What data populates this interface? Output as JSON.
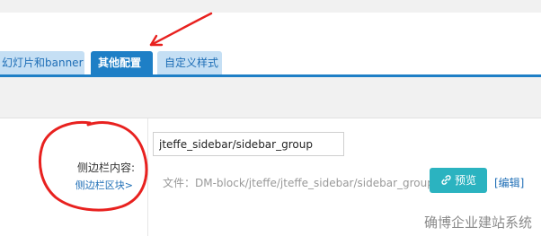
{
  "tabs": [
    {
      "label": "幻灯片和banner",
      "active": false
    },
    {
      "label": "其他配置",
      "active": true
    },
    {
      "label": "自定义样式",
      "active": false
    }
  ],
  "field": {
    "label": "侧边栏内容:",
    "link_label": "侧边栏区块>",
    "input_value": "jteffe_sidebar/sidebar_group",
    "file_path": "文件：DM-block/jteffe/jteffe_sidebar/sidebar_group.php",
    "preview_label": "预览",
    "edit_label": "[编辑]"
  },
  "watermark": "确博企业建站系统",
  "colors": {
    "accent": "#1e7fc6",
    "tab_inactive": "#c5dff4",
    "preview_button": "#2bb3c0",
    "annotation": "#e8211f"
  },
  "icons": {
    "preview": "link-icon"
  }
}
